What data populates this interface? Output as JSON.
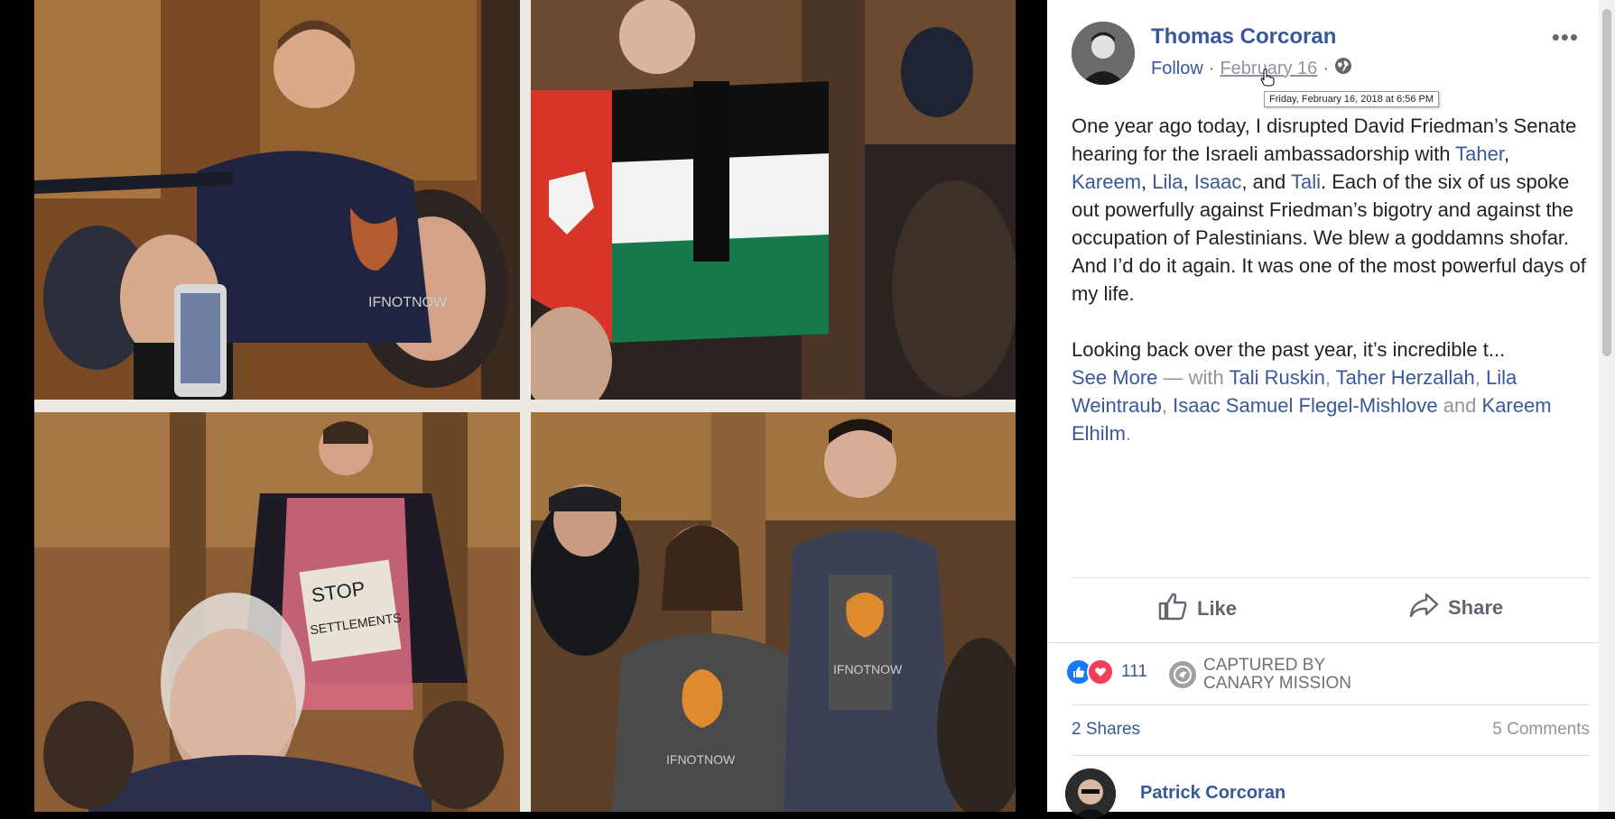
{
  "post": {
    "author": "Thomas Corcoran",
    "follow_label": "Follow",
    "date": "February 16",
    "date_tooltip": "Friday, February 16, 2018 at 6:56 PM",
    "sep": "·",
    "more_label": "•••",
    "text": {
      "p1_a": "One year ago today, I disrupted David Friedman’s Senate hearing for the Israeli ambassadorship with ",
      "tag_taher": "Taher",
      "comma1": ", ",
      "tag_kareem": "Kareem",
      "comma2": ", ",
      "tag_lila": "Lila",
      "comma3": ", ",
      "tag_isaac": "Isaac",
      "and1": ", and ",
      "tag_tali": "Tali",
      "p1_b": ". Each of the six of us spoke out powerfully against Friedman’s bigotry and against the occupation of Palestinians. We blew a goddamns shofar. And I’d do it again. It was one of the most powerful days of my life.",
      "p2": "Looking back over the past year, it’s incredible t...",
      "see_more": "See More",
      "with": " — with ",
      "with_1": "Tali Ruskin",
      "c1": ", ",
      "with_2": "Taher Herzallah",
      "c2": ", ",
      "with_3": "Lila Weintraub",
      "c3": ", ",
      "with_4": "Isaac Samuel Flegel-Mishlove",
      "and2": " and ",
      "with_5": "Kareem Elhilm",
      "period": "."
    }
  },
  "actions": {
    "like_label": "Like",
    "share_label": "Share"
  },
  "reactions": {
    "count": "111"
  },
  "watermark": {
    "line1": "CAPTURED BY",
    "line2": "CANARY MISSION"
  },
  "stats": {
    "shares": "2 Shares",
    "comments": "5 Comments"
  },
  "comment": {
    "author": "Patrick Corcoran"
  },
  "colors": {
    "link": "#385898",
    "like_blue": "#1877f2",
    "love_red": "#f33e58",
    "text": "#1d2129",
    "muted": "#606770"
  },
  "photo_signs": {
    "tshirt": "IFNOTNOW",
    "placard_1": "STOP",
    "placard_2": "SETTLEMENTS"
  }
}
